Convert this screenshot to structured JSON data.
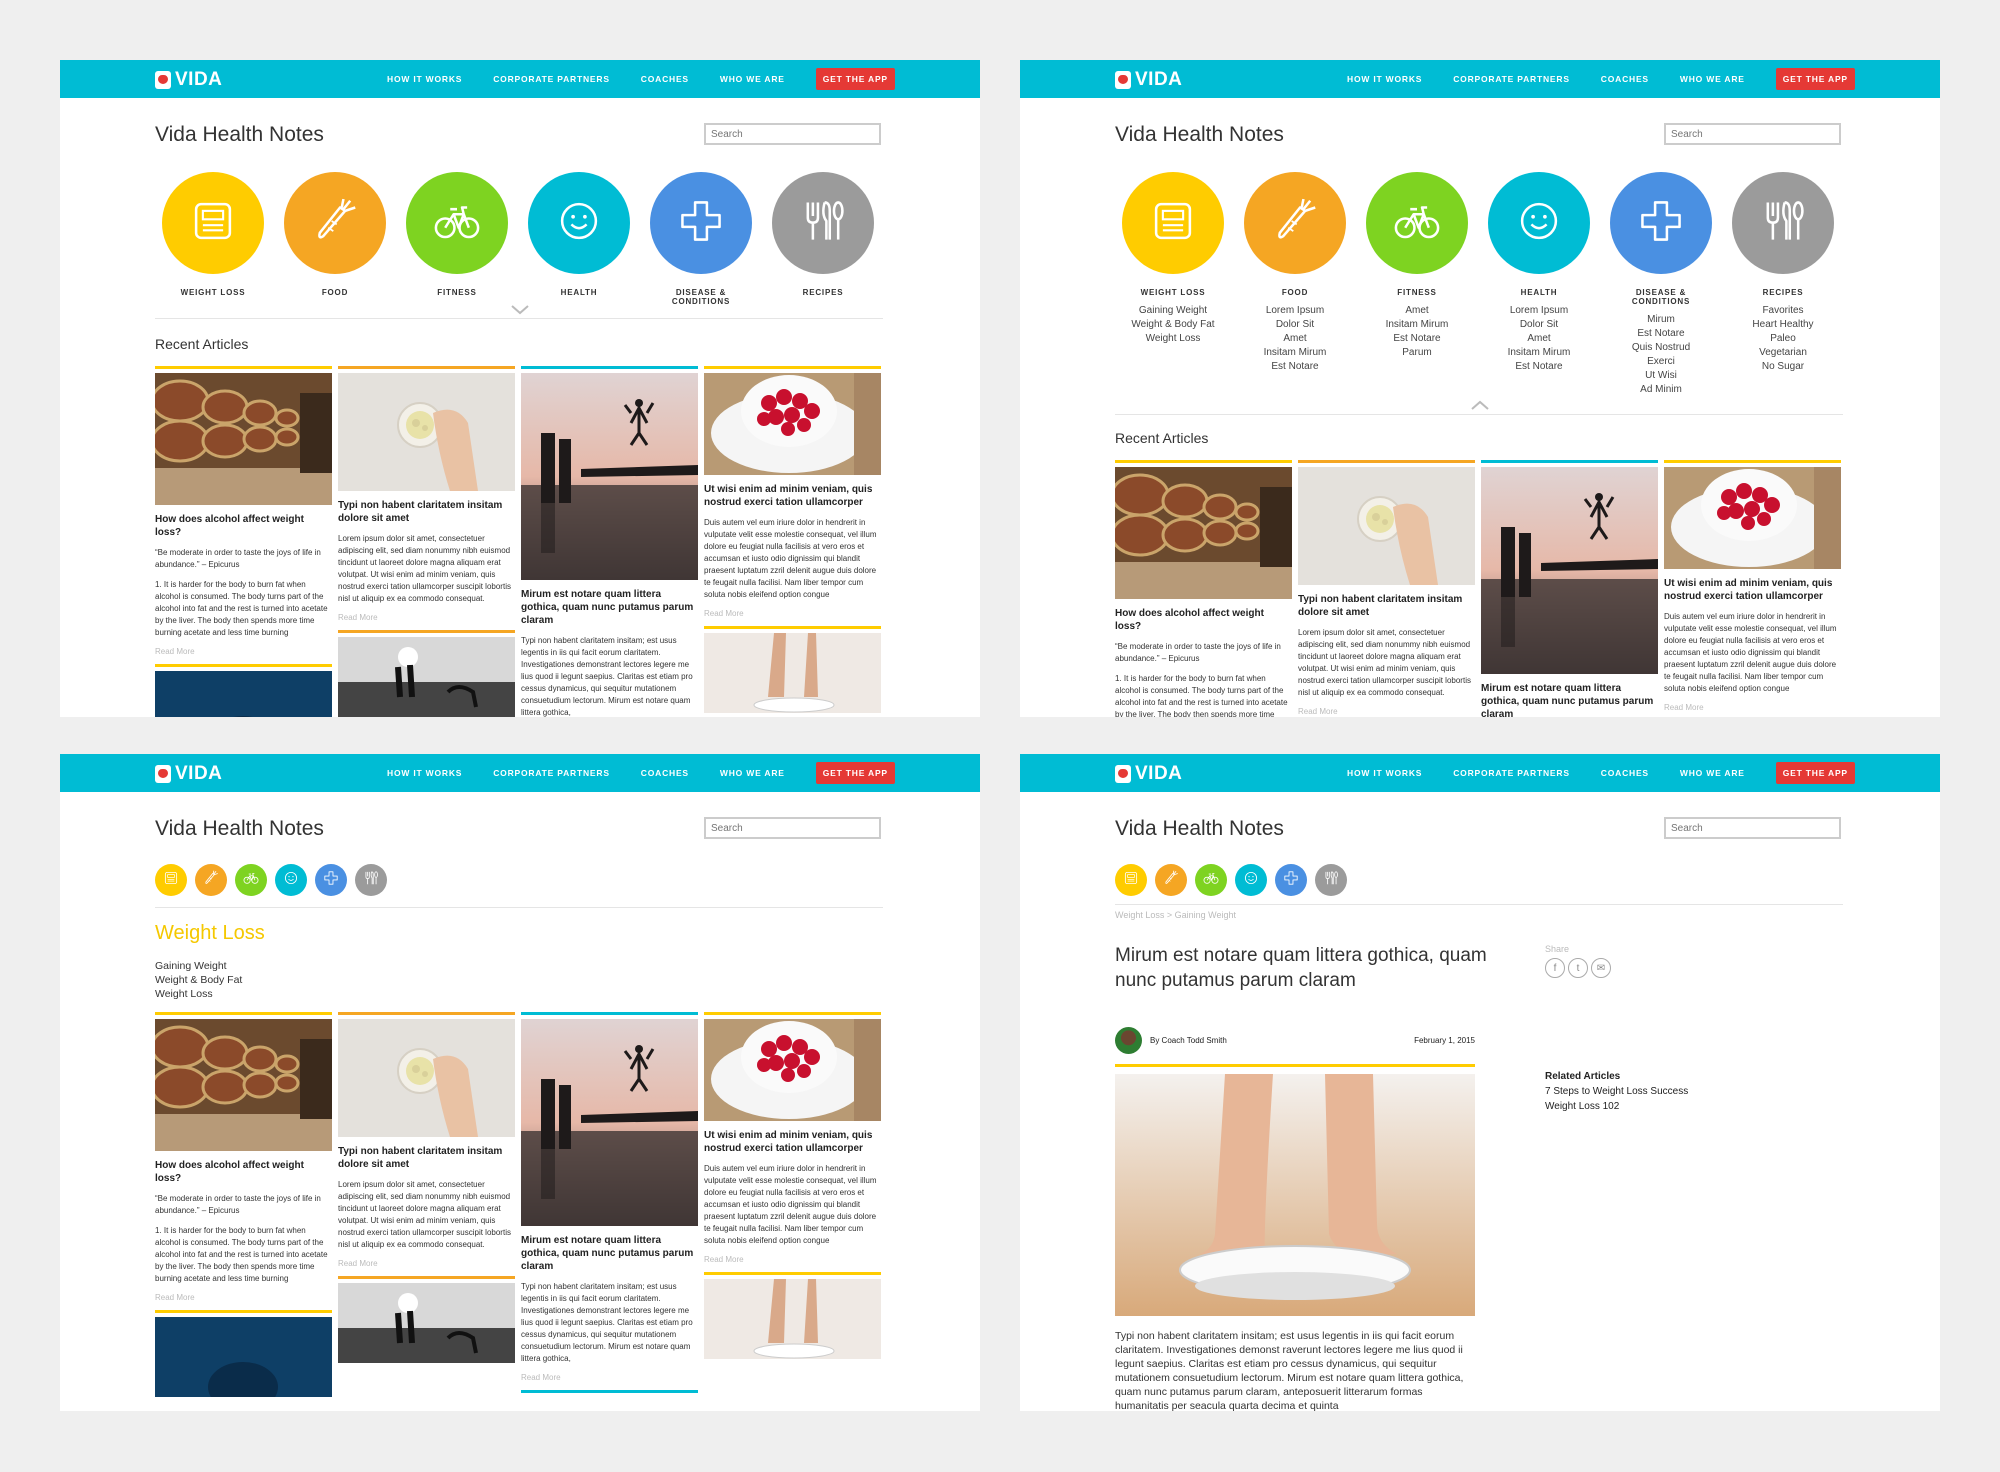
{
  "nav": {
    "logo": "VIDA",
    "links": [
      "HOW IT WORKS",
      "CORPORATE PARTNERS",
      "COACHES",
      "WHO WE ARE"
    ],
    "cta": "GET THE APP"
  },
  "page_title": "Vida Health Notes",
  "search_placeholder": "Search",
  "recent_title": "Recent Articles",
  "categories": [
    {
      "label": "WEIGHT LOSS",
      "color": "#ffcc00",
      "icon": "scale-icon",
      "sub": [
        "Gaining Weight",
        "Weight & Body Fat",
        "Weight Loss"
      ]
    },
    {
      "label": "FOOD",
      "color": "#f5a623",
      "icon": "carrot-icon",
      "sub": [
        "Lorem Ipsum",
        "Dolor Sit",
        "Amet",
        "Insitam Mirum",
        "Est Notare"
      ]
    },
    {
      "label": "FITNESS",
      "color": "#7ed321",
      "icon": "bicycle-icon",
      "sub": [
        "Amet",
        "Insitam Mirum",
        "Est Notare",
        "Parum"
      ]
    },
    {
      "label": "HEALTH",
      "color": "#00bcd4",
      "icon": "smiley-icon",
      "sub": [
        "Lorem Ipsum",
        "Dolor Sit",
        "Amet",
        "Insitam Mirum",
        "Est Notare"
      ]
    },
    {
      "label": "DISEASE & CONDITIONS",
      "color": "#4a90e2",
      "icon": "plus-icon",
      "sub": [
        "Mirum",
        "Est Notare",
        "Quis Nostrud",
        "Exerci",
        "Ut Wisi",
        "Ad Minim"
      ]
    },
    {
      "label": "RECIPES",
      "color": "#9b9b9b",
      "icon": "utensils-icon",
      "sub": [
        "Favorites",
        "Heart Healthy",
        "Paleo",
        "Vegetarian",
        "No Sugar"
      ]
    }
  ],
  "articles": [
    {
      "color": "#ffcc00",
      "title": "How does alcohol affect weight loss?",
      "body1": "“Be moderate in order to taste the joys of life in abundance.” – Epicurus",
      "body2": "1. It is harder for the body to burn fat when alcohol is consumed. The body turns part of the alcohol into fat and the rest is turned into acetate by the liver. The body then spends more time burning acetate and less time burning",
      "more": "Read More",
      "image": "barrels-photo"
    },
    {
      "color": "#f5a623",
      "title": "Typi non habent claritatem insitam dolore sit amet",
      "body1": "Lorem ipsum dolor sit amet, consectetuer adipiscing elit, sed diam nonummy nibh euismod tincidunt ut laoreet dolore magna aliquam erat volutpat. Ut wisi enim ad minim veniam, quis nostrud exerci tation ullamcorper suscipit lobortis nisl ut aliquip ex ea commodo consequat.",
      "body2": "",
      "more": "Read More",
      "image": "bowl-hand-photo"
    },
    {
      "color": "#00bcd4",
      "title": "Mirum est notare quam littera gothica, quam nunc putamus parum claram",
      "body1": "Typi non habent claritatem insitam; est usus legentis in iis qui facit eorum claritatem. Investigationes demonstrant lectores legere me lius quod ii legunt saepius. Claritas est etiam pro cessus dynamicus, qui sequitur mutationem consuetudium lectorum. Mirum est notare quam littera gothica,",
      "body2": "",
      "more": "Read More",
      "image": "pier-jump-photo"
    },
    {
      "color": "#ffcc00",
      "title": "Ut wisi enim ad minim veniam, quis nostrud exerci tation ullamcorper",
      "body1": "Duis autem vel eum iriure dolor in hendrerit in vulputate velit esse molestie consequat, vel illum dolore eu feugiat nulla facilisis at vero eros et accumsan et iusto odio dignissim qui blandit praesent luptatum zzril delenit augue duis dolore te feugait nulla facilisi. Nam liber tempor cum soluta nobis eleifend option congue",
      "body2": "",
      "more": "Read More",
      "image": "raspberries-photo"
    }
  ],
  "category_page": {
    "title": "Weight Loss",
    "sub": [
      "Gaining Weight",
      "Weight & Body Fat",
      "Weight Loss"
    ]
  },
  "article_page": {
    "breadcrumb": "Weight Loss > Gaining Weight",
    "title": "Mirum est notare quam littera gothica, quam nunc putamus parum claram",
    "author": "By Coach Todd Smith",
    "date": "February 1, 2015",
    "share_label": "Share",
    "share_icons": [
      "f",
      "t",
      "✉"
    ],
    "related_title": "Related Articles",
    "related": [
      "7 Steps to Weight Loss Success",
      "Weight Loss 102"
    ],
    "body": "Typi non habent claritatem insitam; est usus legentis in iis qui facit eorum claritatem. Investigationes demonst raverunt lectores legere me lius quod ii legunt saepius. Claritas est etiam pro cessus dynamicus, qui sequitur mutationem consuetudium lectorum. Mirum est notare quam littera gothica, quam nunc putamus parum claram, anteposuerit litterarum formas humanitatis per seacula quarta decima et quinta"
  }
}
